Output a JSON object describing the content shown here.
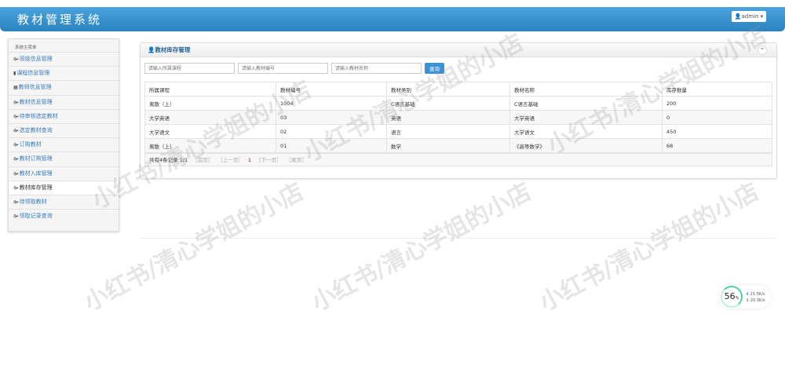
{
  "app_title": "教材管理系统",
  "user": "admin",
  "sidebar": {
    "heading": "系统主菜单",
    "items": [
      {
        "label": "班级信息管理",
        "icon": "leaf-icon"
      },
      {
        "label": "课程信息管理",
        "icon": "bookmark-icon"
      },
      {
        "label": "教师信息管理",
        "icon": "list-icon"
      },
      {
        "label": "教材信息管理",
        "icon": "leaf-icon"
      },
      {
        "label": "待审核选定教材",
        "icon": "leaf-icon"
      },
      {
        "label": "选定教材查询",
        "icon": "leaf-icon"
      },
      {
        "label": "订购教材",
        "icon": "leaf-icon"
      },
      {
        "label": "教材订购管理",
        "icon": "leaf-icon"
      },
      {
        "label": "教材入库管理",
        "icon": "leaf-icon"
      },
      {
        "label": "教材库存管理",
        "icon": "leaf-icon",
        "active": true
      },
      {
        "label": "待领取教材",
        "icon": "leaf-icon"
      },
      {
        "label": "领取记录查询",
        "icon": "leaf-icon"
      }
    ]
  },
  "panel": {
    "title": "教材库存管理",
    "search": {
      "course_placeholder": "请输入所属课程",
      "code_placeholder": "请输入教材编号",
      "name_placeholder": "请输入教材名称",
      "button": "查询"
    },
    "columns": [
      "所属课程",
      "教材编号",
      "教材类别",
      "教材名称",
      "库存数量"
    ],
    "rows": [
      [
        "离散（上）",
        "1004",
        "C语言基础",
        "C语言基础",
        "200"
      ],
      [
        "大学英语",
        "03",
        "英语",
        "大学英语",
        "0"
      ],
      [
        "大学语文",
        "02",
        "语言",
        "大学语文",
        "450"
      ],
      [
        "离散（上）",
        "01",
        "数学",
        "《高等数学》",
        "68"
      ]
    ],
    "pager": {
      "summary": "共有4条记录",
      "pages": "1/1",
      "first": "［首页］",
      "prev": "［上一页］",
      "current": "1",
      "next": "［下一页］",
      "last": "［尾页］"
    }
  },
  "speed": {
    "percent": "56",
    "unit": "%",
    "up": "21.5K/s",
    "down": "20.3K/s"
  },
  "watermark": "小红书/清心学姐的小店"
}
